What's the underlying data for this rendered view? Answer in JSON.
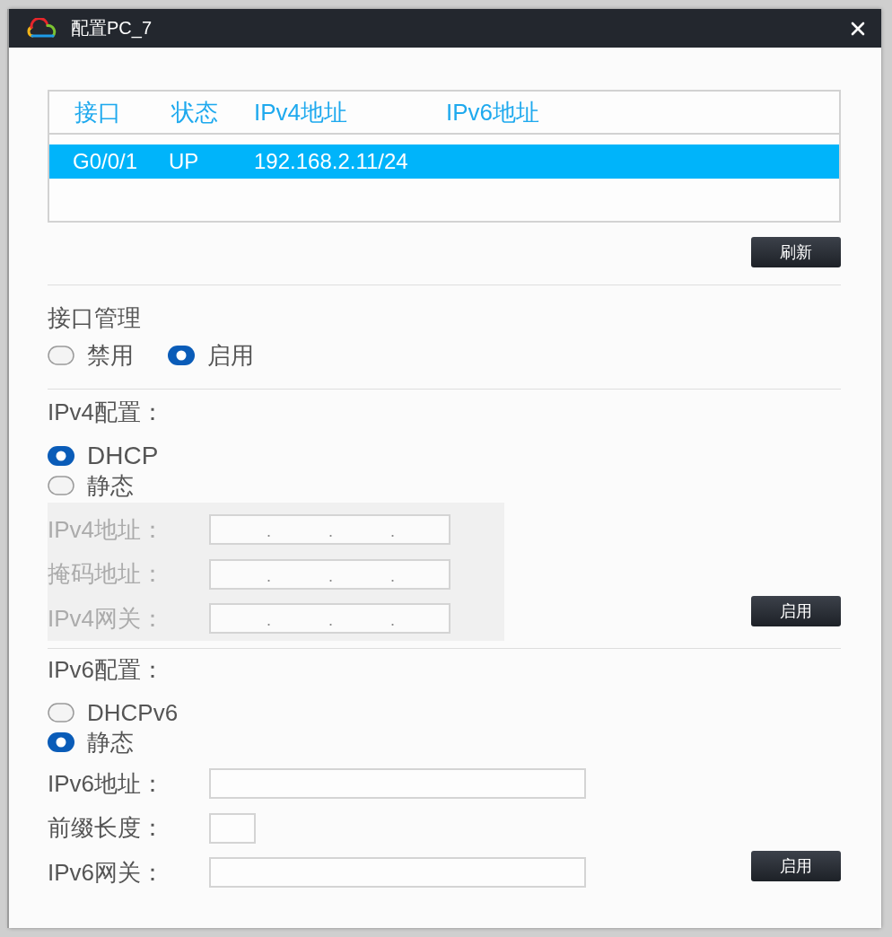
{
  "window": {
    "title": "配置PC_7"
  },
  "interface_table": {
    "columns": [
      "接口",
      "状态",
      "IPv4地址",
      "IPv6地址"
    ],
    "rows": [
      {
        "cells": [
          "G0/0/1",
          "UP",
          "192.168.2.11/24"
        ],
        "selected": true
      }
    ]
  },
  "refresh_button": "刷新",
  "interface_management": {
    "title": "接口管理",
    "options": [
      {
        "label": "禁用",
        "selected": false
      },
      {
        "label": "启用",
        "selected": true
      }
    ]
  },
  "ipv4_config": {
    "title": "IPv4配置：",
    "options": [
      {
        "label": "DHCP",
        "selected": true
      },
      {
        "label": "静态",
        "selected": false
      }
    ],
    "fields_disabled": true,
    "fields": [
      {
        "label": "IPv4地址：",
        "separator": "."
      },
      {
        "label": "掩码地址：",
        "separator": "."
      },
      {
        "label": "IPv4网关：",
        "separator": "."
      }
    ],
    "apply_button": "启用"
  },
  "ipv6_config": {
    "title": "IPv6配置：",
    "options": [
      {
        "label": "DHCPv6",
        "selected": false
      },
      {
        "label": "静态",
        "selected": true
      }
    ],
    "fields": [
      {
        "label": "IPv6地址：",
        "kind": "wide"
      },
      {
        "label": "前缀长度：",
        "kind": "short"
      },
      {
        "label": "IPv6网关：",
        "kind": "wide"
      }
    ],
    "apply_button": "启用"
  }
}
